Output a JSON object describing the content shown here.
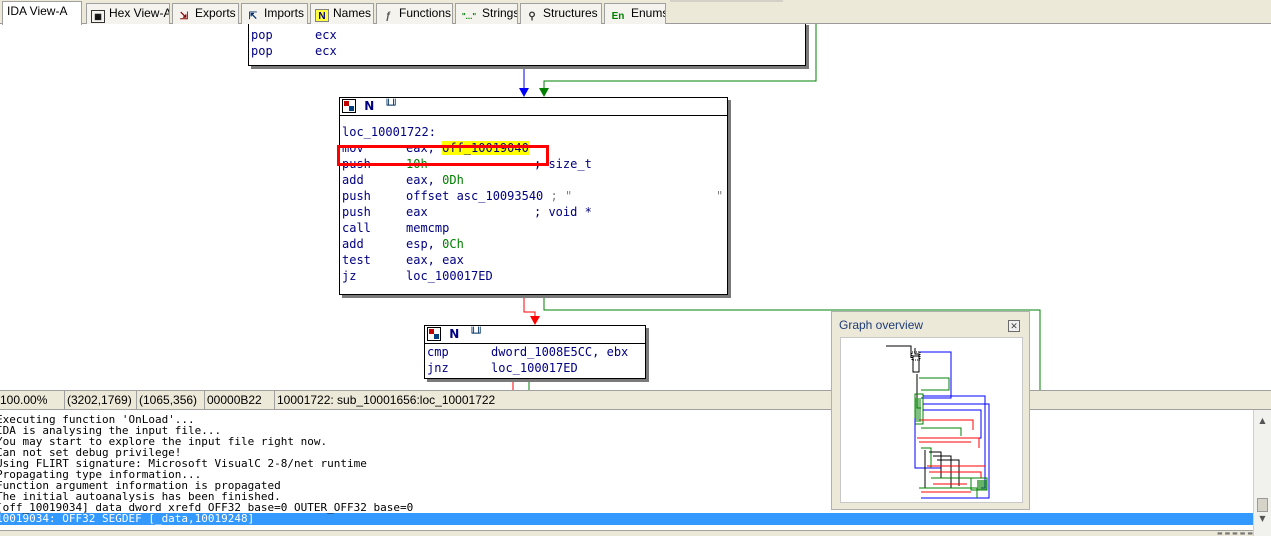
{
  "tabs": [
    {
      "label": "IDA View-A",
      "icon": "ida-view-icon",
      "active": true
    },
    {
      "label": "Hex View-A",
      "icon": "hex-view-icon",
      "active": false
    },
    {
      "label": "Exports",
      "icon": "exports-icon",
      "active": false
    },
    {
      "label": "Imports",
      "icon": "imports-icon",
      "active": false
    },
    {
      "label": "Names",
      "icon": "names-icon",
      "glyph": "N",
      "active": false
    },
    {
      "label": "Functions",
      "icon": "functions-icon",
      "active": false
    },
    {
      "label": "Strings",
      "icon": "strings-icon",
      "glyph": "\"...\"",
      "active": false
    },
    {
      "label": "Structures",
      "icon": "structures-icon",
      "active": false
    },
    {
      "label": "Enums",
      "icon": "enums-icon",
      "glyph": "En",
      "active": false
    }
  ],
  "graph": {
    "block_top": {
      "lines": [
        {
          "mnemonic": "pop",
          "operand": "ecx"
        },
        {
          "mnemonic": "pop",
          "operand": "ecx"
        }
      ]
    },
    "block_main": {
      "label": "loc_10001722:",
      "lines": [
        {
          "mnemonic": "mov",
          "operand_a": "eax, ",
          "operand_b": "off_10019040",
          "highlight": true
        },
        {
          "mnemonic": "push",
          "operand_a": "10h",
          "comment": "; size_t"
        },
        {
          "mnemonic": "add",
          "operand_a": "eax, ",
          "operand_b": "0Dh"
        },
        {
          "mnemonic": "push",
          "operand_a": "offset asc_10093540",
          "comment": "; \""
        },
        {
          "mnemonic": "push",
          "operand_a": "eax",
          "comment": "; void *"
        },
        {
          "mnemonic": "call",
          "operand_a": "memcmp"
        },
        {
          "mnemonic": "add",
          "operand_a": "esp, ",
          "operand_b": "0Ch"
        },
        {
          "mnemonic": "test",
          "operand_a": "eax, eax"
        },
        {
          "mnemonic": "jz",
          "operand_a": "loc_100017ED"
        }
      ],
      "trailing_quote": "\""
    },
    "block_bottom": {
      "lines": [
        {
          "mnemonic": "cmp",
          "operand_a": "dword_1008E5CC, ebx"
        },
        {
          "mnemonic": "jnz",
          "operand_a": "loc_100017ED"
        }
      ]
    },
    "colors": {
      "true_edge": "#008000",
      "false_edge": "#ff0000",
      "normal_edge": "#0000ff",
      "highlight": "#ffff00",
      "selection_box": "#ff0000"
    }
  },
  "overview": {
    "title": "Graph overview",
    "close_icon": "close-icon"
  },
  "status": {
    "zoom": "100.00%",
    "coords": "(3202,1769)",
    "mouse": "(1065,356)",
    "offset": "00000B22",
    "location": "10001722: sub_10001656:loc_10001722"
  },
  "output": {
    "lines": [
      "Executing function 'OnLoad'...",
      "IDA is analysing the input file...",
      "You may start to explore the input file right now.",
      "Can not set debug privilege!",
      "Using FLIRT signature: Microsoft VisualC 2-8/net runtime",
      "Propagating type information...",
      "Function argument information is propagated",
      "The initial autoanalysis has been finished.",
      "[off_10019034] data dword xrefd OFF32 base=0 OUTER_OFF32 base=0",
      "10019034: OFF32 SEGDEF [_data,10019248]"
    ],
    "selected_index": 9
  }
}
